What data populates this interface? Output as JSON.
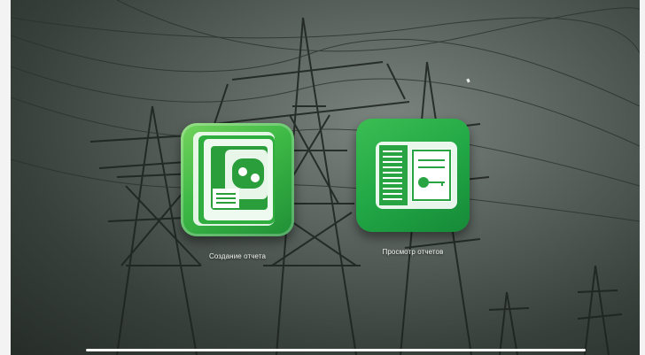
{
  "apps": [
    {
      "label": "Создание отчета",
      "icon": "create-report-icon"
    },
    {
      "label": "Просмотр отчетов",
      "icon": "view-reports-icon"
    }
  ],
  "colors": {
    "accent_green": "#3db845",
    "dark_green": "#1f8f36",
    "label_text": "#f2f5f3"
  }
}
